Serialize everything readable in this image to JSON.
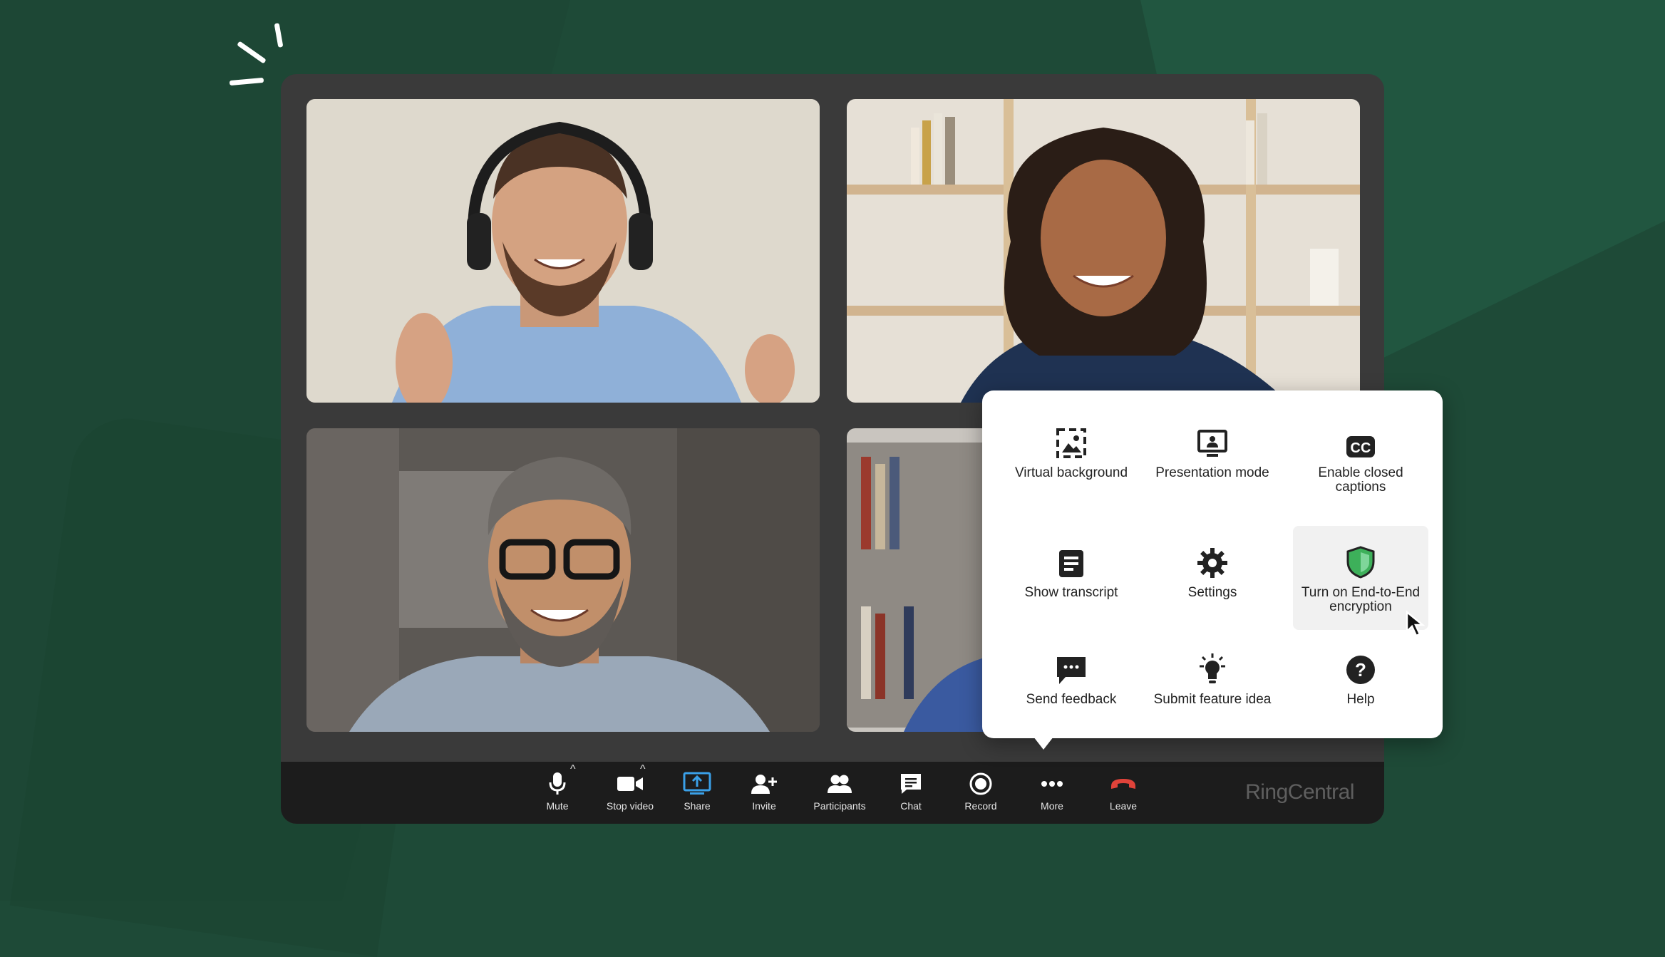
{
  "brand": "RingCentral",
  "colors": {
    "background": "#1e4a37",
    "toolbar": "#1c1c1c",
    "share_accent": "#3aa0e8",
    "leave_red": "#e0433a",
    "shield_green": "#3db05a"
  },
  "toolbar": {
    "items": [
      {
        "label": "Mute",
        "icon": "microphone-icon"
      },
      {
        "label": "Stop video",
        "icon": "video-camera-icon"
      },
      {
        "label": "Share",
        "icon": "share-screen-icon"
      },
      {
        "label": "Invite",
        "icon": "add-person-icon"
      },
      {
        "label": "Participants",
        "icon": "participants-icon"
      },
      {
        "label": "Chat",
        "icon": "chat-icon"
      },
      {
        "label": "Record",
        "icon": "record-icon"
      },
      {
        "label": "More",
        "icon": "more-dots-icon"
      },
      {
        "label": "Leave",
        "icon": "hang-up-icon"
      }
    ]
  },
  "more_menu": {
    "items": [
      {
        "label": "Virtual background",
        "icon": "virtual-background-icon"
      },
      {
        "label": "Presentation mode",
        "icon": "presentation-icon"
      },
      {
        "label": "Enable closed captions",
        "icon": "closed-captions-icon"
      },
      {
        "label": "Show transcript",
        "icon": "transcript-icon"
      },
      {
        "label": "Settings",
        "icon": "gear-icon"
      },
      {
        "label": "Turn on End-to-End encryption",
        "icon": "shield-icon"
      },
      {
        "label": "Send feedback",
        "icon": "feedback-icon"
      },
      {
        "label": "Submit feature idea",
        "icon": "lightbulb-icon"
      },
      {
        "label": "Help",
        "icon": "help-icon"
      }
    ]
  }
}
